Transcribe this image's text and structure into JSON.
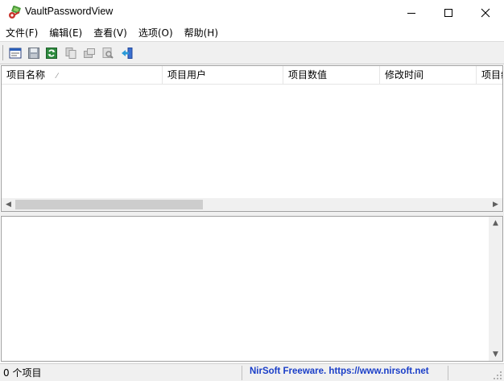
{
  "window": {
    "title": "VaultPasswordView"
  },
  "menu": [
    {
      "label": "文件(F)"
    },
    {
      "label": "编辑(E)"
    },
    {
      "label": "查看(V)"
    },
    {
      "label": "选项(O)"
    },
    {
      "label": "帮助(H)"
    }
  ],
  "toolbar": {
    "icons": [
      "properties-icon",
      "save-icon",
      "refresh-icon",
      "copy-icon",
      "html-report-icon",
      "find-icon",
      "exit-icon"
    ]
  },
  "list": {
    "columns": [
      {
        "label": "项目名称",
        "sorted": "ascending"
      },
      {
        "label": "项目用户"
      },
      {
        "label": "项目数值"
      },
      {
        "label": "修改时间"
      },
      {
        "label": "项目编"
      }
    ],
    "rows": []
  },
  "status": {
    "count": "0 个项目",
    "link": "NirSoft Freeware. https://www.nirsoft.net"
  }
}
